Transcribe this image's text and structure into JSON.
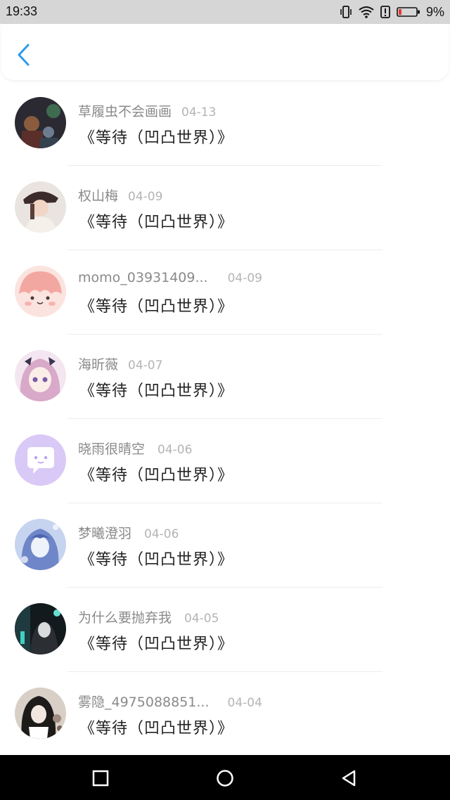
{
  "status_bar": {
    "time": "19:33",
    "battery": "9%",
    "icons": [
      "vibrate-icon",
      "wifi-icon",
      "alert-icon",
      "battery-icon"
    ],
    "battery_color": "#e53935"
  },
  "header": {
    "back_icon": "chevron-left-icon",
    "accent_color": "#2d9be8"
  },
  "list": {
    "items": [
      {
        "name": "草履虫不会画画",
        "date": "04-13",
        "title": "《等待（凹凸世界）》",
        "avatar": "avatar-1"
      },
      {
        "name": "权山梅",
        "date": "04-09",
        "title": "《等待（凹凸世界）》",
        "avatar": "avatar-2"
      },
      {
        "name": "momo_03931409...",
        "date": "04-09",
        "title": "《等待（凹凸世界）》",
        "avatar": "avatar-3"
      },
      {
        "name": "海昕薇",
        "date": "04-07",
        "title": "《等待（凹凸世界）》",
        "avatar": "avatar-4"
      },
      {
        "name": "晓雨很晴空",
        "date": "04-06",
        "title": "《等待（凹凸世界）》",
        "avatar": "avatar-5"
      },
      {
        "name": "梦曦澄羽",
        "date": "04-06",
        "title": "《等待（凹凸世界）》",
        "avatar": "avatar-6"
      },
      {
        "name": "为什么要抛弃我",
        "date": "04-05",
        "title": "《等待（凹凸世界）》",
        "avatar": "avatar-7"
      },
      {
        "name": "雾隐_4975088851...",
        "date": "04-04",
        "title": "《等待（凹凸世界）》",
        "avatar": "avatar-8"
      }
    ]
  },
  "nav_bar": {
    "buttons": [
      "recents-square-icon",
      "home-circle-icon",
      "back-triangle-icon"
    ]
  }
}
